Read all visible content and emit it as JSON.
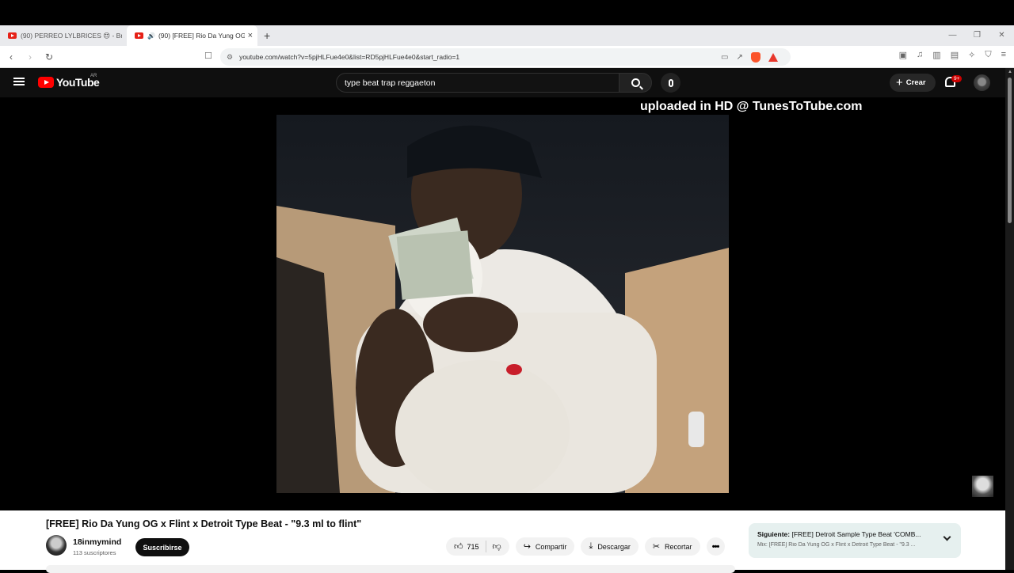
{
  "browser": {
    "tabs": [
      {
        "title": "(90) PERREO LYLBRICES 😍 - Bruno",
        "active": false
      },
      {
        "title": "(90) [FREE] Rio Da Yung OG x",
        "active": true
      }
    ],
    "new_tab": "+",
    "url": "youtube.com/watch?v=5pjHLFue4e0&list=RD5pjHLFue4e0&start_radio=1"
  },
  "youtube": {
    "logo_text": "YouTube",
    "country_code": "AR",
    "search_value": "type beat trap reggaeton",
    "create_label": "Crear",
    "notification_badge": "9+"
  },
  "player": {
    "watermark": "uploaded in HD @ TunesToTube.com"
  },
  "video": {
    "title": "[FREE] Rio Da Yung OG x Flint x Detroit Type Beat - \"9.3 ml to flint\"",
    "channel_name": "18inmymind",
    "subscribers": "113 suscriptores",
    "subscribe_label": "Suscribirse",
    "likes": "715",
    "share_label": "Compartir",
    "download_label": "Descargar",
    "clip_label": "Recortar"
  },
  "up_next": {
    "prefix": "Siguiente:",
    "title": "[FREE] Detroit Sample Type Beat 'COMB...",
    "mix": "Mix: [FREE] Rio Da Yung OG x Flint x Detroit Type Beat - \"9.3 ..."
  },
  "colors": {
    "yt_red": "#ff0000",
    "dark_bg": "#0f0f0f",
    "up_next_bg": "#e6f0ef"
  }
}
